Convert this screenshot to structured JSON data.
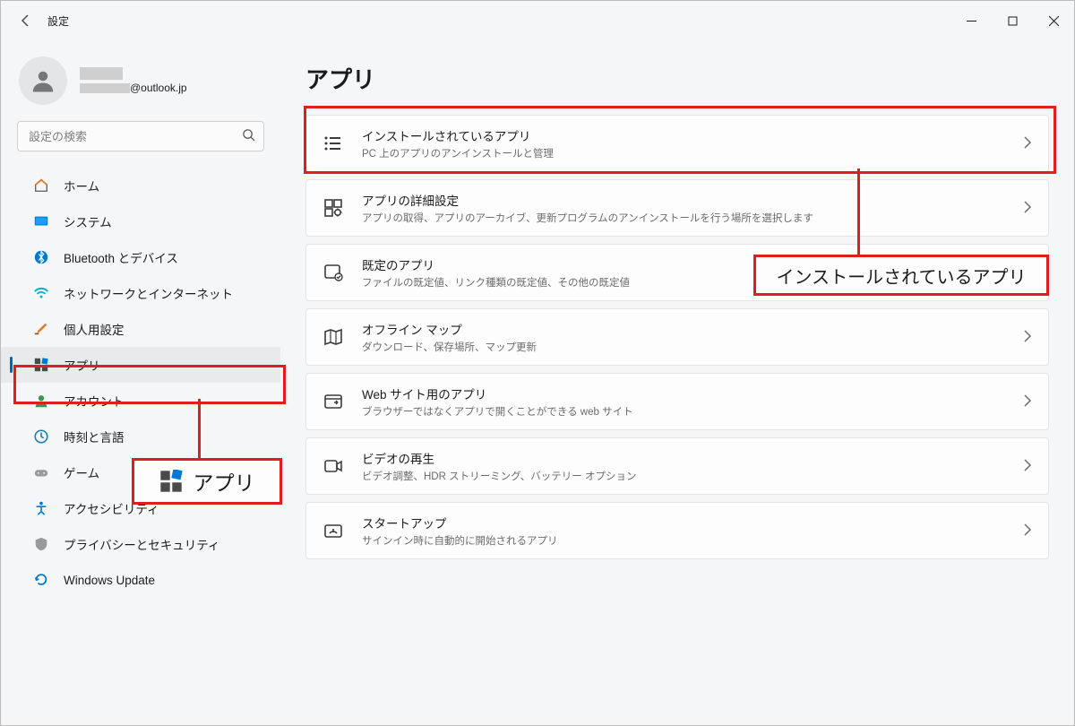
{
  "window": {
    "title": "設定"
  },
  "user": {
    "email_suffix": "@outlook.jp"
  },
  "search": {
    "placeholder": "設定の検索"
  },
  "sidebar": {
    "items": [
      {
        "label": "ホーム"
      },
      {
        "label": "システム"
      },
      {
        "label": "Bluetooth とデバイス"
      },
      {
        "label": "ネットワークとインターネット"
      },
      {
        "label": "個人用設定"
      },
      {
        "label": "アプリ"
      },
      {
        "label": "アカウント"
      },
      {
        "label": "時刻と言語"
      },
      {
        "label": "ゲーム"
      },
      {
        "label": "アクセシビリティ"
      },
      {
        "label": "プライバシーとセキュリティ"
      },
      {
        "label": "Windows Update"
      }
    ]
  },
  "page": {
    "title": "アプリ"
  },
  "cards": [
    {
      "title": "インストールされているアプリ",
      "subtitle": "PC 上のアプリのアンインストールと管理"
    },
    {
      "title": "アプリの詳細設定",
      "subtitle": "アプリの取得、アプリのアーカイブ、更新プログラムのアンインストールを行う場所を選択します"
    },
    {
      "title": "既定のアプリ",
      "subtitle": "ファイルの既定値、リンク種類の既定値、その他の既定値"
    },
    {
      "title": "オフライン マップ",
      "subtitle": "ダウンロード、保存場所、マップ更新"
    },
    {
      "title": "Web サイト用のアプリ",
      "subtitle": "ブラウザーではなくアプリで開くことができる web サイト"
    },
    {
      "title": "ビデオの再生",
      "subtitle": "ビデオ調整、HDR ストリーミング、バッテリー オプション"
    },
    {
      "title": "スタートアップ",
      "subtitle": "サインイン時に自動的に開始されるアプリ"
    }
  ],
  "annotations": {
    "callout1": "インストールされているアプリ",
    "callout2": "アプリ"
  }
}
